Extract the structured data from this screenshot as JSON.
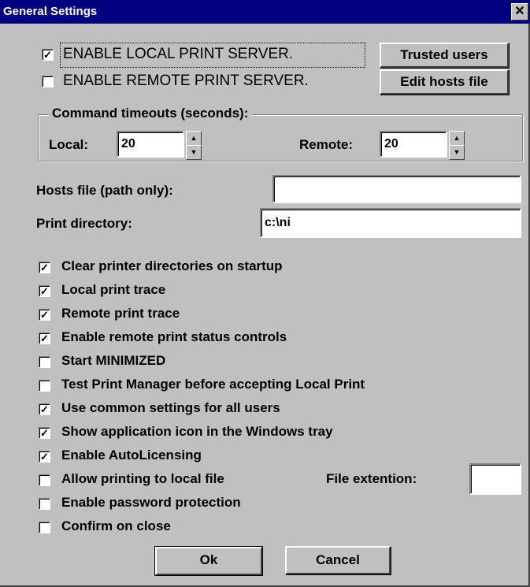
{
  "window": {
    "title": "General Settings",
    "close_glyph": "✕"
  },
  "server": {
    "local_label": "ENABLE LOCAL PRINT SERVER.",
    "local_checked": true,
    "remote_label": "ENABLE REMOTE PRINT SERVER.",
    "remote_checked": false
  },
  "buttons": {
    "trusted_users": "Trusted users",
    "edit_hosts": "Edit hosts file",
    "ok": "Ok",
    "cancel": "Cancel"
  },
  "timeouts": {
    "legend": "Command timeouts (seconds):",
    "local_label": "Local:",
    "local_value": "20",
    "remote_label": "Remote:",
    "remote_value": "20"
  },
  "fields": {
    "hosts_label": "Hosts file (path only):",
    "hosts_value": "",
    "print_dir_label": "Print directory:",
    "print_dir_value": "c:\\ni",
    "file_ext_label": "File extention:",
    "file_ext_value": ""
  },
  "options": [
    {
      "label": "Clear printer directories on startup",
      "checked": true
    },
    {
      "label": "Local print trace",
      "checked": true
    },
    {
      "label": "Remote print trace",
      "checked": true
    },
    {
      "label": "Enable remote print status controls",
      "checked": true
    },
    {
      "label": "Start MINIMIZED",
      "checked": false
    },
    {
      "label": "Test Print Manager before accepting Local Print",
      "checked": false
    },
    {
      "label": "Use common settings for all users",
      "checked": true
    },
    {
      "label": "Show application icon in the Windows tray",
      "checked": true
    },
    {
      "label": "Enable AutoLicensing",
      "checked": true
    },
    {
      "label": "Allow printing to local file",
      "checked": false
    },
    {
      "label": "Enable password protection",
      "checked": false
    },
    {
      "label": "Confirm on close",
      "checked": false
    }
  ],
  "check_glyph": "✓"
}
